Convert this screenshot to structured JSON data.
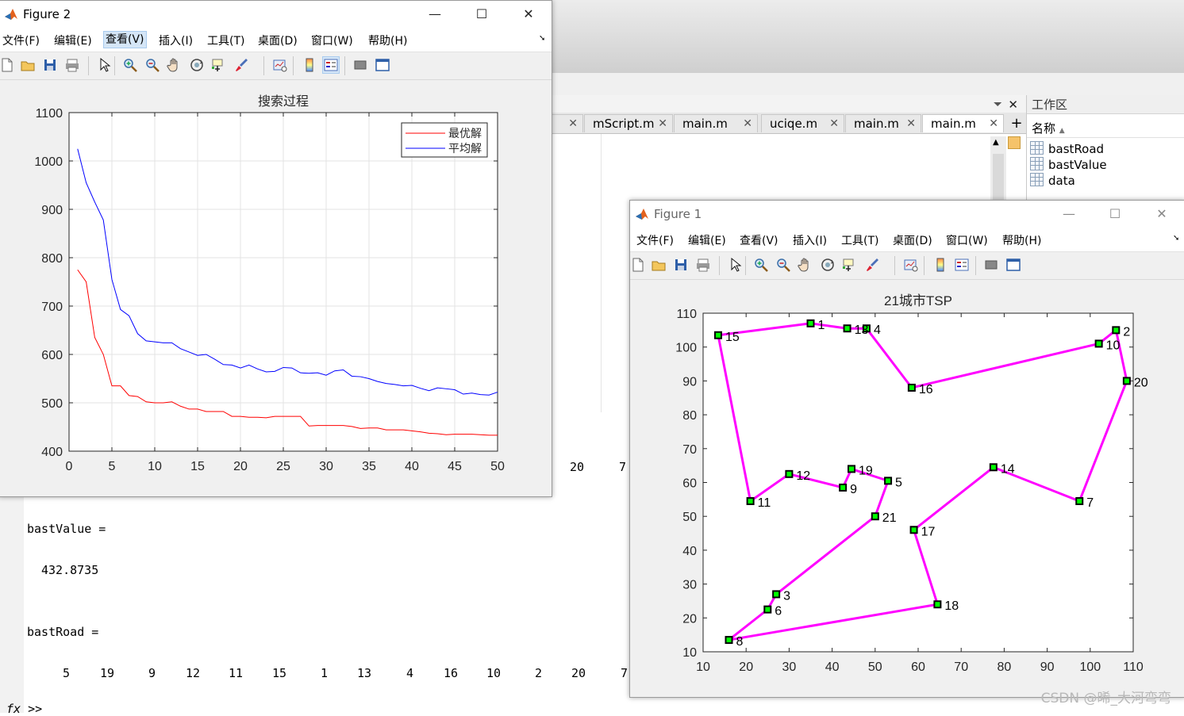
{
  "editor": {
    "tabs": [
      {
        "label": "",
        "active": false
      },
      {
        "label": "mScript.m",
        "active": false
      },
      {
        "label": "main.m",
        "active": false
      },
      {
        "label": "uciqe.m",
        "active": false
      },
      {
        "label": "main.m",
        "active": false
      },
      {
        "label": "main.m",
        "active": true
      }
    ],
    "close_glyph": "✕",
    "add_glyph": "+"
  },
  "workspace": {
    "title": "工作区",
    "column_header": "名称",
    "sort_glyph": "▲",
    "variables": [
      "bastRoad",
      "bastValue",
      "data"
    ]
  },
  "command_window": {
    "top_row_partial": [
      "20",
      "7"
    ],
    "value_label": "bastValue =",
    "value": "432.8735",
    "road_label": "bastRoad =",
    "road": [
      "5",
      "19",
      "9",
      "12",
      "11",
      "15",
      "1",
      "13",
      "4",
      "16",
      "10",
      "2",
      "20",
      "7"
    ],
    "prompt": "fx >>"
  },
  "figure2": {
    "title": "Figure 2",
    "menus": [
      "文件(F)",
      "编辑(E)",
      "查看(V)",
      "插入(I)",
      "工具(T)",
      "桌面(D)",
      "窗口(W)",
      "帮助(H)"
    ],
    "selected_menu": "查看(V)",
    "toolbar_icons": [
      "new-file-icon",
      "open-folder-icon",
      "save-icon",
      "print-icon",
      "pointer-icon",
      "zoom-in-icon",
      "zoom-out-icon",
      "pan-hand-icon",
      "rotate-3d-icon",
      "data-cursor-icon",
      "brush-icon",
      "link-plot-icon",
      "colorbar-icon",
      "legend-icon",
      "hide-tools-icon",
      "show-tools-icon"
    ]
  },
  "figure1": {
    "title": "Figure 1",
    "menus": [
      "文件(F)",
      "编辑(E)",
      "查看(V)",
      "插入(I)",
      "工具(T)",
      "桌面(D)",
      "窗口(W)",
      "帮助(H)"
    ]
  },
  "window_controls": {
    "minimize": "—",
    "maximize": "☐",
    "close": "✕"
  },
  "watermark": "CSDN @晞_大河弯弯",
  "chart_data": [
    {
      "type": "line",
      "title": "搜索过程",
      "xlim": [
        0,
        50
      ],
      "ylim": [
        400,
        1100
      ],
      "xticks": [
        0,
        5,
        10,
        15,
        20,
        25,
        30,
        35,
        40,
        45,
        50
      ],
      "yticks": [
        400,
        500,
        600,
        700,
        800,
        900,
        1000,
        1100
      ],
      "grid": true,
      "legend_position": "top-right",
      "series": [
        {
          "name": "最优解",
          "color": "#ff0000",
          "x": [
            1,
            2,
            3,
            4,
            5,
            6,
            7,
            8,
            9,
            10,
            11,
            12,
            13,
            14,
            15,
            16,
            17,
            18,
            19,
            20,
            21,
            22,
            23,
            24,
            25,
            26,
            27,
            28,
            29,
            30,
            31,
            32,
            33,
            34,
            35,
            36,
            37,
            38,
            39,
            40,
            41,
            42,
            43,
            44,
            45,
            46,
            47,
            48,
            49,
            50
          ],
          "values": [
            775,
            750,
            635,
            600,
            535,
            535,
            515,
            513,
            502,
            500,
            500,
            502,
            493,
            487,
            487,
            482,
            482,
            482,
            472,
            472,
            470,
            470,
            469,
            472,
            472,
            472,
            472,
            452,
            453,
            453,
            453,
            453,
            451,
            447,
            448,
            448,
            444,
            444,
            444,
            442,
            440,
            437,
            436,
            434,
            435,
            435,
            435,
            434,
            433,
            433
          ]
        },
        {
          "name": "平均解",
          "color": "#0000ff",
          "x": [
            1,
            2,
            3,
            4,
            5,
            6,
            7,
            8,
            9,
            10,
            11,
            12,
            13,
            14,
            15,
            16,
            17,
            18,
            19,
            20,
            21,
            22,
            23,
            24,
            25,
            26,
            27,
            28,
            29,
            30,
            31,
            32,
            33,
            34,
            35,
            36,
            37,
            38,
            39,
            40,
            41,
            42,
            43,
            44,
            45,
            46,
            47,
            48,
            49,
            50
          ],
          "values": [
            1025,
            955,
            915,
            878,
            755,
            693,
            680,
            643,
            628,
            626,
            624,
            624,
            612,
            605,
            598,
            600,
            590,
            579,
            578,
            572,
            578,
            570,
            564,
            565,
            573,
            572,
            562,
            561,
            562,
            557,
            566,
            568,
            555,
            554,
            550,
            544,
            540,
            538,
            535,
            536,
            530,
            525,
            531,
            529,
            527,
            518,
            520,
            517,
            516,
            522
          ]
        }
      ]
    },
    {
      "type": "scatter",
      "title": "21城市TSP",
      "xlim": [
        10,
        110
      ],
      "ylim": [
        10,
        110
      ],
      "xticks": [
        10,
        20,
        30,
        40,
        50,
        60,
        70,
        80,
        90,
        100,
        110
      ],
      "yticks": [
        10,
        20,
        30,
        40,
        50,
        60,
        70,
        80,
        90,
        100,
        110
      ],
      "grid": false,
      "line_color": "#ff00ff",
      "marker_fill": "#00ff00",
      "marker_edge": "#000000",
      "cities": [
        {
          "id": "1",
          "x": 35,
          "y": 107
        },
        {
          "id": "2",
          "x": 106,
          "y": 105
        },
        {
          "id": "3",
          "x": 27,
          "y": 27
        },
        {
          "id": "4",
          "x": 48,
          "y": 105.5
        },
        {
          "id": "5",
          "x": 53,
          "y": 60.5
        },
        {
          "id": "6",
          "x": 25,
          "y": 22.5
        },
        {
          "id": "7",
          "x": 97.5,
          "y": 54.5
        },
        {
          "id": "8",
          "x": 16,
          "y": 13.5
        },
        {
          "id": "9",
          "x": 42.5,
          "y": 58.5
        },
        {
          "id": "10",
          "x": 102,
          "y": 101
        },
        {
          "id": "11",
          "x": 21,
          "y": 54.5
        },
        {
          "id": "12",
          "x": 30,
          "y": 62.5
        },
        {
          "id": "13",
          "x": 43.5,
          "y": 105.5
        },
        {
          "id": "14",
          "x": 77.5,
          "y": 64.5
        },
        {
          "id": "15",
          "x": 13.5,
          "y": 103.5
        },
        {
          "id": "16",
          "x": 58.5,
          "y": 88
        },
        {
          "id": "17",
          "x": 59,
          "y": 46
        },
        {
          "id": "18",
          "x": 64.5,
          "y": 24
        },
        {
          "id": "19",
          "x": 44.5,
          "y": 64
        },
        {
          "id": "20",
          "x": 108.5,
          "y": 90
        },
        {
          "id": "21",
          "x": 50,
          "y": 50
        }
      ],
      "route": [
        "5",
        "19",
        "9",
        "12",
        "11",
        "15",
        "1",
        "13",
        "4",
        "16",
        "10",
        "2",
        "20",
        "7",
        "14",
        "17",
        "18",
        "8",
        "6",
        "3",
        "21",
        "5"
      ]
    }
  ]
}
